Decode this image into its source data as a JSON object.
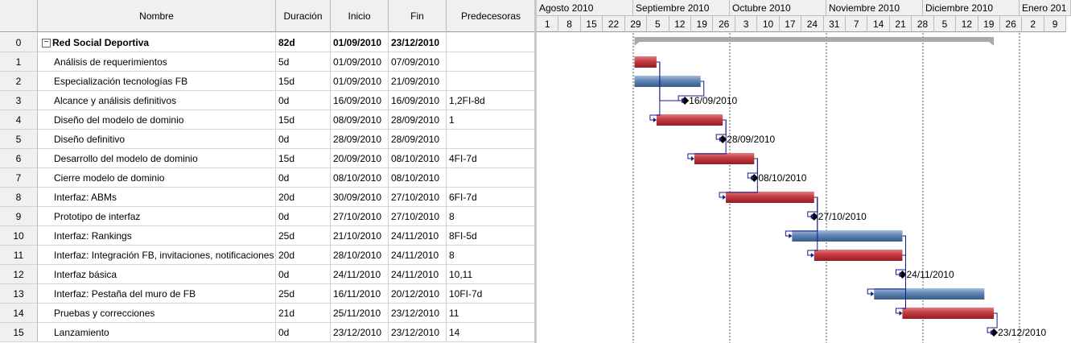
{
  "columns": {
    "nombre": "Nombre",
    "duracion": "Duración",
    "inicio": "Inicio",
    "fin": "Fin",
    "predecesoras": "Predecesoras"
  },
  "tasks": [
    {
      "id": "0",
      "name": "Red Social Deportiva",
      "duration": "82d",
      "start": "01/09/2010",
      "end": "23/12/2010",
      "pred": "",
      "summary": true,
      "kind": "summary"
    },
    {
      "id": "1",
      "name": "Análisis de requerimientos",
      "duration": "5d",
      "start": "01/09/2010",
      "end": "07/09/2010",
      "pred": "",
      "kind": "critical"
    },
    {
      "id": "2",
      "name": "Especialización tecnologías FB",
      "duration": "15d",
      "start": "01/09/2010",
      "end": "21/09/2010",
      "pred": "",
      "kind": "normal"
    },
    {
      "id": "3",
      "name": "Alcance y análisis definitivos",
      "duration": "0d",
      "start": "16/09/2010",
      "end": "16/09/2010",
      "pred": "1,2FI-8d",
      "kind": "milestone",
      "label": "16/09/2010"
    },
    {
      "id": "4",
      "name": "Diseño del modelo de dominio",
      "duration": "15d",
      "start": "08/09/2010",
      "end": "28/09/2010",
      "pred": "1",
      "kind": "critical"
    },
    {
      "id": "5",
      "name": "Diseño definitivo",
      "duration": "0d",
      "start": "28/09/2010",
      "end": "28/09/2010",
      "pred": "",
      "kind": "milestone",
      "label": "28/09/2010"
    },
    {
      "id": "6",
      "name": "Desarrollo del modelo de dominio",
      "duration": "15d",
      "start": "20/09/2010",
      "end": "08/10/2010",
      "pred": "4FI-7d",
      "kind": "critical"
    },
    {
      "id": "7",
      "name": "Cierre modelo de dominio",
      "duration": "0d",
      "start": "08/10/2010",
      "end": "08/10/2010",
      "pred": "",
      "kind": "milestone",
      "label": "08/10/2010"
    },
    {
      "id": "8",
      "name": "Interfaz: ABMs",
      "duration": "20d",
      "start": "30/09/2010",
      "end": "27/10/2010",
      "pred": "6FI-7d",
      "kind": "critical"
    },
    {
      "id": "9",
      "name": "Prototipo de interfaz",
      "duration": "0d",
      "start": "27/10/2010",
      "end": "27/10/2010",
      "pred": "8",
      "kind": "milestone",
      "label": "27/10/2010"
    },
    {
      "id": "10",
      "name": "Interfaz: Rankings",
      "duration": "25d",
      "start": "21/10/2010",
      "end": "24/11/2010",
      "pred": "8FI-5d",
      "kind": "normal"
    },
    {
      "id": "11",
      "name": "Interfaz: Integración FB, invitaciones, notificaciones",
      "duration": "20d",
      "start": "28/10/2010",
      "end": "24/11/2010",
      "pred": "8",
      "kind": "critical"
    },
    {
      "id": "12",
      "name": "Interfaz básica",
      "duration": "0d",
      "start": "24/11/2010",
      "end": "24/11/2010",
      "pred": "10,11",
      "kind": "milestone",
      "label": "24/11/2010"
    },
    {
      "id": "13",
      "name": "Interfaz: Pestaña del muro de FB",
      "duration": "25d",
      "start": "16/11/2010",
      "end": "20/12/2010",
      "pred": "10FI-7d",
      "kind": "normal"
    },
    {
      "id": "14",
      "name": "Pruebas y correcciones",
      "duration": "21d",
      "start": "25/11/2010",
      "end": "23/12/2010",
      "pred": "11",
      "kind": "critical"
    },
    {
      "id": "15",
      "name": "Lanzamiento",
      "duration": "0d",
      "start": "23/12/2010",
      "end": "23/12/2010",
      "pred": "14",
      "kind": "milestone",
      "label": "23/12/2010"
    }
  ],
  "timeline": {
    "months": [
      "Agosto 2010",
      "Septiembre 2010",
      "Octubre 2010",
      "Noviembre 2010",
      "Diciembre 2010",
      "Enero 201"
    ],
    "weeks": [
      "1",
      "8",
      "15",
      "22",
      "29",
      "5",
      "12",
      "19",
      "26",
      "3",
      "10",
      "17",
      "24",
      "31",
      "7",
      "14",
      "21",
      "28",
      "5",
      "12",
      "19",
      "26",
      "2",
      "9"
    ]
  },
  "colors": {
    "critical": "#c0373c",
    "normal": "#5a7fae",
    "summary": "#a9a9a9",
    "milestone": "#000000",
    "link": "#1a1a8c",
    "header_bg": "#f0f0f0"
  }
}
